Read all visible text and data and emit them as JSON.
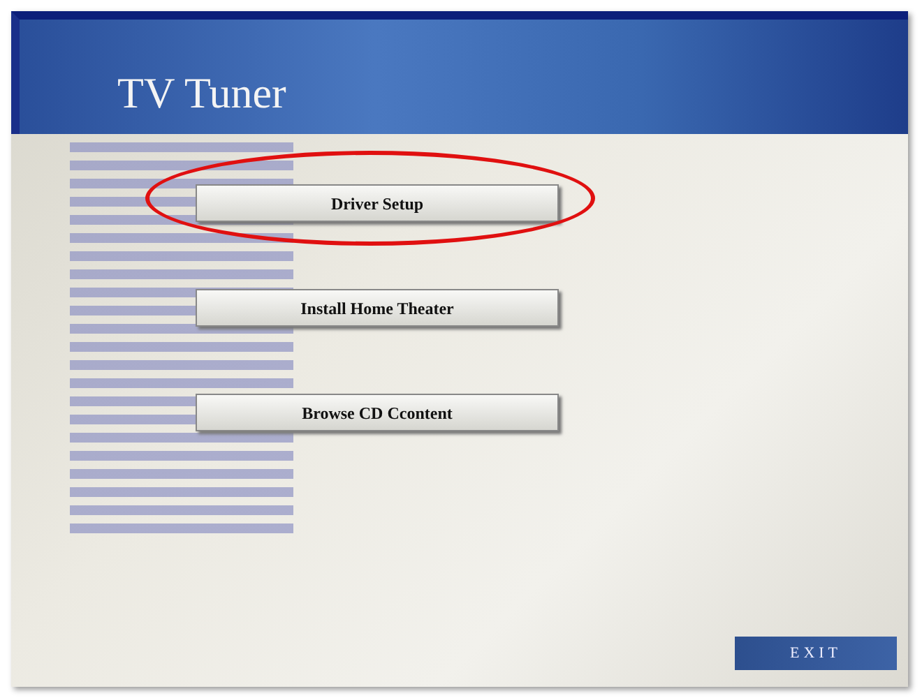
{
  "header": {
    "title": "TV Tuner"
  },
  "buttons": [
    {
      "label": "Driver Setup",
      "highlighted": true
    },
    {
      "label": "Install Home Theater",
      "highlighted": false
    },
    {
      "label": "Browse CD Ccontent",
      "highlighted": false
    }
  ],
  "exit_button": {
    "label": "EXIT"
  }
}
